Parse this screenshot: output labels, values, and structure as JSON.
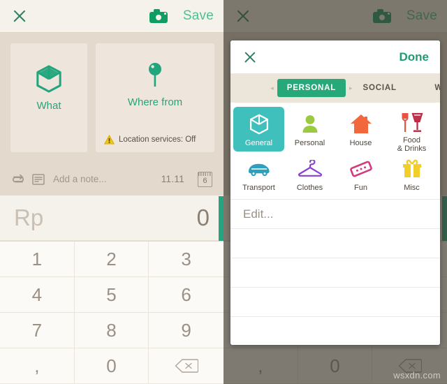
{
  "colors": {
    "green": "#23a680",
    "save_green": "#4fbf93",
    "teal_selected": "#3fc0bd",
    "tab_active": "#26a879",
    "page_bg": "#e3d9cd",
    "card_bg": "#eee6dc",
    "keypad_bg": "#fbfaf7",
    "backdrop": "#5d5a52"
  },
  "topbar": {
    "close_icon": "close-icon",
    "camera_icon": "camera-icon",
    "save_label": "Save"
  },
  "cards": {
    "what": {
      "icon": "box-icon",
      "label": "What"
    },
    "where": {
      "icon": "map-pin-icon",
      "label": "Where from",
      "warning_icon": "warning-icon",
      "warning_text": "Location services: Off"
    }
  },
  "noterow": {
    "repeat_icon": "repeat-icon",
    "note_icon": "note-lines-icon",
    "note_placeholder": "Add a note...",
    "time": "11.11",
    "calendar_icon": "calendar-icon",
    "calendar_day": "6"
  },
  "amount": {
    "currency": "Rp",
    "value": "0"
  },
  "keypad": {
    "keys": [
      "1",
      "2",
      "3",
      "4",
      "5",
      "6",
      "7",
      "8",
      "9",
      ",",
      "0",
      "backspace-icon"
    ],
    "backspace_label": "backspace-icon"
  },
  "modal": {
    "close_icon": "close-icon",
    "done_label": "Done",
    "tabs": [
      {
        "label": "PERSONAL",
        "active": true
      },
      {
        "label": "SOCIAL",
        "active": false
      },
      {
        "label": "W",
        "active": false
      }
    ],
    "categories": [
      {
        "label": "General",
        "icon": "box-icon",
        "selected": true
      },
      {
        "label": "Personal",
        "icon": "person-icon",
        "selected": false
      },
      {
        "label": "House",
        "icon": "house-icon",
        "selected": false
      },
      {
        "label": "Food\n& Drinks",
        "icon": "food-drinks-icon",
        "selected": false
      },
      {
        "label": "Transport",
        "icon": "car-icon",
        "selected": false
      },
      {
        "label": "Clothes",
        "icon": "hanger-icon",
        "selected": false
      },
      {
        "label": "Fun",
        "icon": "ticket-icon",
        "selected": false
      },
      {
        "label": "Misc",
        "icon": "gift-icon",
        "selected": false
      }
    ],
    "list": [
      {
        "label": "Edit..."
      },
      {
        "label": ""
      },
      {
        "label": ""
      },
      {
        "label": ""
      },
      {
        "label": ""
      }
    ]
  },
  "watermark": "wsxdn.com"
}
